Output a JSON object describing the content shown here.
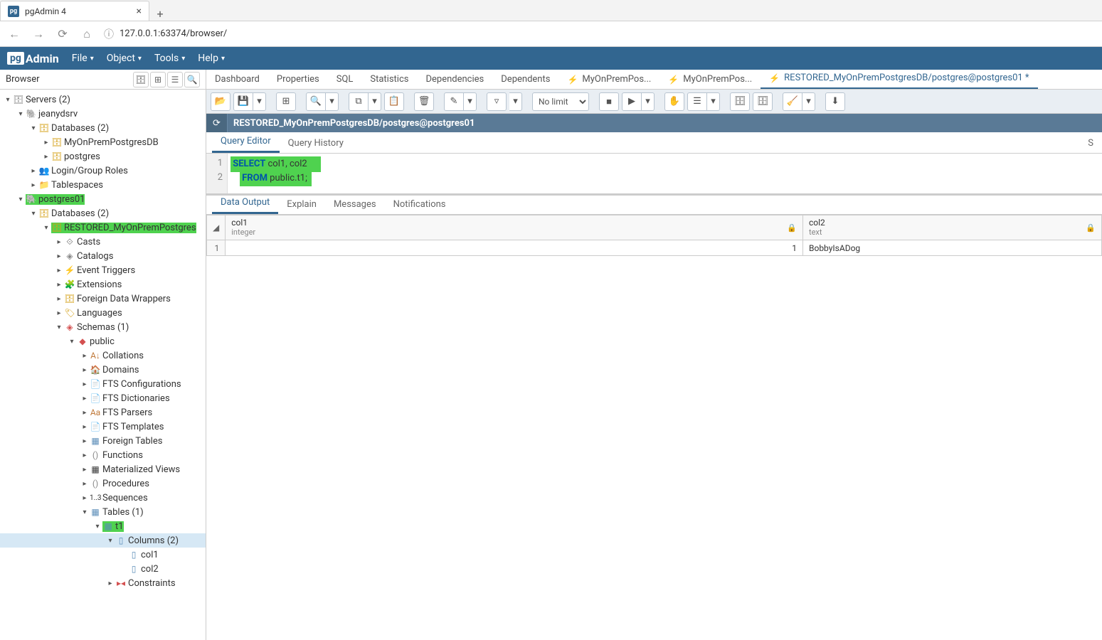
{
  "browser": {
    "tab_title": "pgAdmin 4",
    "url": "127.0.0.1:63374/browser/"
  },
  "menubar": {
    "file": "File",
    "object": "Object",
    "tools": "Tools",
    "help": "Help"
  },
  "sidebar": {
    "title": "Browser",
    "servers": "Servers (2)",
    "srv1": "jeanydsrv",
    "dbs1": "Databases (2)",
    "db1": "MyOnPremPostgresDB",
    "db2": "postgres",
    "roles": "Login/Group Roles",
    "tbs": "Tablespaces",
    "srv2": "postgres01",
    "dbs2": "Databases (2)",
    "restored": "RESTORED_MyOnPremPostgres",
    "casts": "Casts",
    "catalogs": "Catalogs",
    "evt": "Event Triggers",
    "ext": "Extensions",
    "fdw": "Foreign Data Wrappers",
    "lang": "Languages",
    "schemas": "Schemas (1)",
    "public": "public",
    "coll": "Collations",
    "dom": "Domains",
    "ftsc": "FTS Configurations",
    "ftsd": "FTS Dictionaries",
    "ftsp": "FTS Parsers",
    "ftst": "FTS Templates",
    "ftab": "Foreign Tables",
    "func": "Functions",
    "mview": "Materialized Views",
    "proc": "Procedures",
    "seq": "Sequences",
    "tables": "Tables (1)",
    "t1": "t1",
    "cols": "Columns (2)",
    "c1": "col1",
    "c2": "col2",
    "cons": "Constraints"
  },
  "maintabs": {
    "dashboard": "Dashboard",
    "properties": "Properties",
    "sql": "SQL",
    "statistics": "Statistics",
    "dependencies": "Dependencies",
    "dependents": "Dependents",
    "q1": "MyOnPremPos...",
    "q2": "MyOnPremPos...",
    "q3": "RESTORED_MyOnPremPostgresDB/postgres@postgres01 *"
  },
  "toolbar": {
    "limit": "No limit"
  },
  "connection": "RESTORED_MyOnPremPostgresDB/postgres@postgres01",
  "editor_tabs": {
    "qe": "Query Editor",
    "qh": "Query History",
    "scratch": "S"
  },
  "sql": {
    "l1_kw": "SELECT",
    "l1_rest": " col1, col2",
    "l2_kw": "FROM",
    "l2_mid": " public",
    "l2_end": ".t1;"
  },
  "result_tabs": {
    "data": "Data Output",
    "explain": "Explain",
    "msg": "Messages",
    "notif": "Notifications"
  },
  "grid": {
    "col1": {
      "name": "col1",
      "type": "integer"
    },
    "col2": {
      "name": "col2",
      "type": "text"
    },
    "row1": {
      "n": "1",
      "c1": "1",
      "c2": "BobbyIsADog"
    }
  }
}
